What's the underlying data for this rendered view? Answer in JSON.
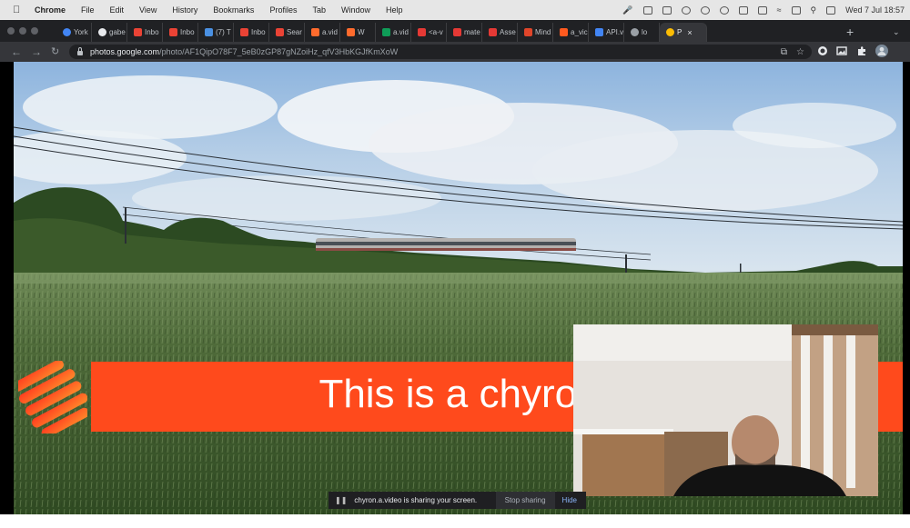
{
  "menubar": {
    "app": "Chrome",
    "items": [
      "File",
      "Edit",
      "View",
      "History",
      "Bookmarks",
      "Profiles",
      "Tab",
      "Window",
      "Help"
    ],
    "clock": "Wed 7 Jul  18:57"
  },
  "tabs": [
    {
      "label": "York",
      "icon": "chrome-icon",
      "color": "#4285f4"
    },
    {
      "label": "gabe",
      "icon": "github-icon",
      "color": "#e8eaed"
    },
    {
      "label": "Inbo",
      "icon": "gmail-icon",
      "color": "#ea4335"
    },
    {
      "label": "Inbo",
      "icon": "gmail-icon",
      "color": "#ea4335"
    },
    {
      "label": "(7) T",
      "icon": "cloud-icon",
      "color": "#4a90e2"
    },
    {
      "label": "Inbo",
      "icon": "gmail-icon",
      "color": "#ea4335"
    },
    {
      "label": "Sear",
      "icon": "gmail-icon",
      "color": "#ea4335"
    },
    {
      "label": "a.vid",
      "icon": "avideo-icon",
      "color": "#ff6b2d"
    },
    {
      "label": "W",
      "icon": "avideo-icon",
      "color": "#ff6b2d"
    },
    {
      "label": "a.vid",
      "icon": "sheets-icon",
      "color": "#0f9d58"
    },
    {
      "label": "<a-v",
      "icon": "a-icon",
      "color": "#e53935"
    },
    {
      "label": "mate",
      "icon": "a-icon",
      "color": "#e53935"
    },
    {
      "label": "Asse",
      "icon": "a-icon",
      "color": "#e53935"
    },
    {
      "label": "Mind",
      "icon": "box-icon",
      "color": "#e0452a"
    },
    {
      "label": "a_vic",
      "icon": "d-icon",
      "color": "#ff5a1f"
    },
    {
      "label": "API.v",
      "icon": "docs-icon",
      "color": "#4285f4"
    },
    {
      "label": "lo",
      "icon": "globe-icon",
      "color": "#9aa0a6"
    },
    {
      "label": "P",
      "icon": "photos-icon",
      "color": "#fbbc04",
      "active": true
    }
  ],
  "address": {
    "host": "photos.google.com",
    "path": "/photo/AF1QipO78F7_5eB0zGP87gNZoiHz_qfV3HbKGJfKmXoW"
  },
  "chyron": {
    "text": "This is a chyron",
    "color": "#ff4a1c"
  },
  "share_bar": {
    "message": "chyron.a.video is sharing your screen.",
    "stop": "Stop sharing",
    "hide": "Hide"
  }
}
